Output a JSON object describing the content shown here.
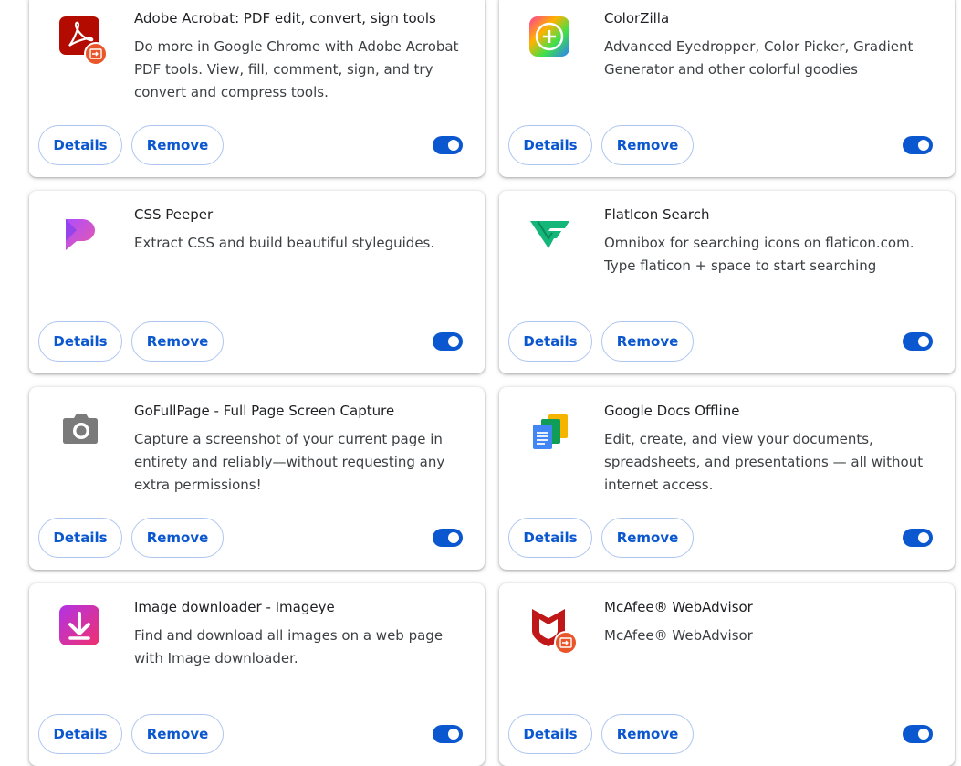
{
  "buttons": {
    "details": "Details",
    "remove": "Remove"
  },
  "extensions": [
    {
      "name": "Adobe Acrobat: PDF edit, convert, sign tools",
      "description": "Do more in Google Chrome with Adobe Acrobat PDF tools. View, fill, comment, sign, and try convert and compress tools.",
      "icon": "adobe-acrobat-icon",
      "enabled": true,
      "badge": "managed-by-policy-icon"
    },
    {
      "name": "ColorZilla",
      "description": "Advanced Eyedropper, Color Picker, Gradient Generator and other colorful goodies",
      "icon": "colorzilla-icon",
      "enabled": true
    },
    {
      "name": "CSS Peeper",
      "description": "Extract CSS and build beautiful styleguides.",
      "icon": "css-peeper-icon",
      "enabled": true
    },
    {
      "name": "FlatIcon Search",
      "description": "Omnibox for searching icons on flaticon.com. Type flaticon + space to start searching",
      "icon": "flaticon-icon",
      "enabled": true
    },
    {
      "name": "GoFullPage - Full Page Screen Capture",
      "description": "Capture a screenshot of your current page in entirety and reliably—without requesting any extra permissions!",
      "icon": "camera-icon",
      "enabled": true
    },
    {
      "name": "Google Docs Offline",
      "description": "Edit, create, and view your documents, spreadsheets, and presentations — all without internet access.",
      "icon": "google-docs-offline-icon",
      "enabled": true
    },
    {
      "name": "Image downloader - Imageye",
      "description": "Find and download all images on a web page with Image downloader.",
      "icon": "image-downloader-icon",
      "enabled": true
    },
    {
      "name": "McAfee® WebAdvisor",
      "description": "McAfee® WebAdvisor",
      "icon": "mcafee-icon",
      "enabled": true,
      "badge": "managed-by-policy-icon"
    }
  ],
  "colors": {
    "accent": "#0b57d0",
    "toggle_on": "#0b57d0",
    "badge": "#e8562a"
  }
}
